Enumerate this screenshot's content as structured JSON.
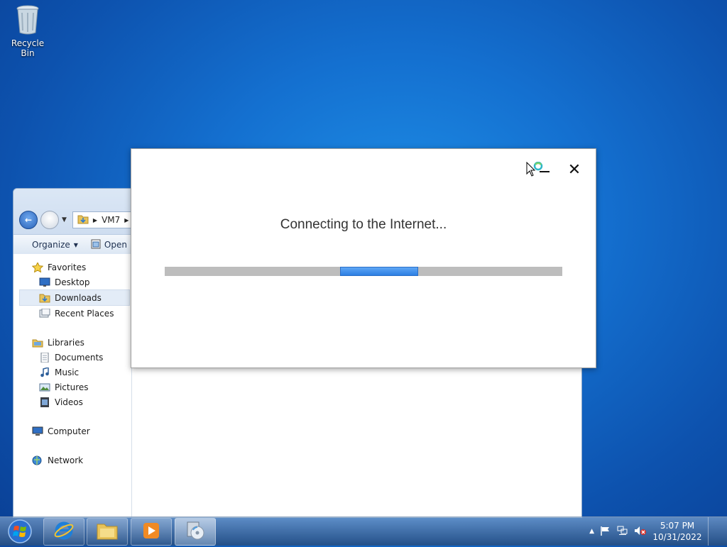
{
  "desktop": {
    "recycle_bin_label": "Recycle Bin"
  },
  "explorer": {
    "address_path": "VM7",
    "toolbar": {
      "organize_label": "Organize",
      "open_label": "Open"
    },
    "nav": {
      "favorites": {
        "label": "Favorites",
        "items": [
          "Desktop",
          "Downloads",
          "Recent Places"
        ]
      },
      "libraries": {
        "label": "Libraries",
        "items": [
          "Documents",
          "Music",
          "Pictures",
          "Videos"
        ]
      },
      "computer_label": "Computer",
      "network_label": "Network"
    }
  },
  "dialog": {
    "title": "Connecting to the Internet...",
    "progress_fraction": 0.2,
    "minimize_icon": "minimize-icon",
    "close_icon": "close-icon"
  },
  "taskbar": {
    "apps": [
      "internet-explorer-icon",
      "windows-explorer-icon",
      "media-player-icon",
      "setup-disc-icon"
    ],
    "clock": {
      "time": "5:07 PM",
      "date": "10/31/2022"
    }
  }
}
